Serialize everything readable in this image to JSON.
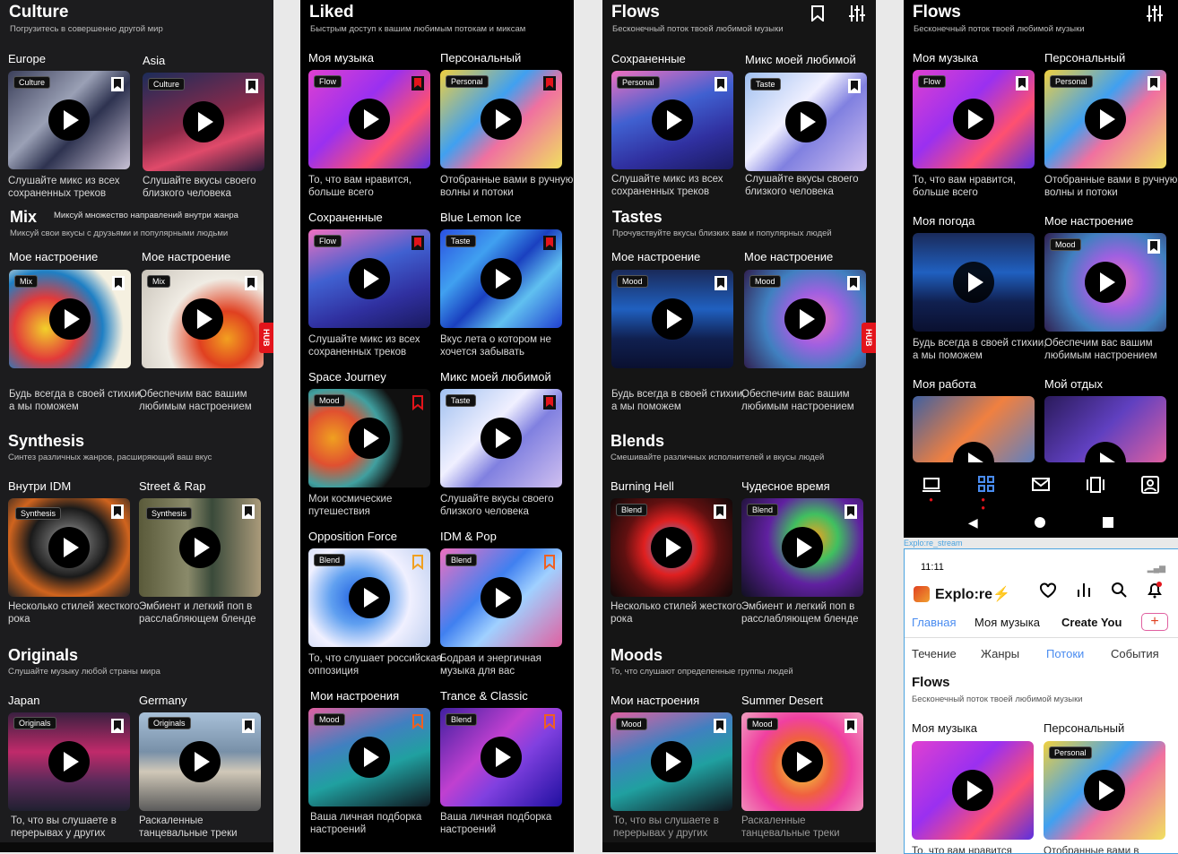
{
  "panel1": {
    "title": "Culture",
    "subtitle": "Погрузитесь в совершенно другой мир",
    "cards": [
      {
        "title": "Europe",
        "badge": "Culture",
        "desc": "Слушайте микс из всех сохраненных треков"
      },
      {
        "title": "Asia",
        "badge": "Culture",
        "desc": "Слушайте вкусы своего близкого человека"
      }
    ],
    "mix_title": "Mix",
    "mix_side": "Миксуй множество направлений внутри жанра",
    "mix_sub": "Миксуй свои вкусы с друзьями и популярными людьми",
    "mix_cards": [
      {
        "title": "Мое настроение",
        "badge": "Mix",
        "desc": "Будь всегда в своей стихии, а мы поможем"
      },
      {
        "title": "Мое настроение",
        "badge": "Mix",
        "desc": "Обеспечим вас вашим любимым настроением"
      }
    ],
    "hub": "HUB",
    "syn_title": "Synthesis",
    "syn_sub": "Синтез различных жанров, расширяющий ваш вкус",
    "syn_cards": [
      {
        "title": "Внутри IDM",
        "badge": "Synthesis",
        "desc": "Несколько стилей жесткого рока"
      },
      {
        "title": "Street & Rap",
        "badge": "Synthesis",
        "desc": "Эмбиент и легкий поп в расслабляющем бленде"
      }
    ],
    "orig_title": "Originals",
    "orig_sub": "Слушайте музыку любой страны мира",
    "orig_cards": [
      {
        "title": "Japan",
        "badge": "Originals",
        "desc": "То, что вы слушаете в перерывах у других"
      },
      {
        "title": "Germany",
        "badge": "Originals",
        "desc": "Раскаленные танцевальные треки"
      }
    ]
  },
  "panel2": {
    "title": "Liked",
    "subtitle": "Быстрым доступ к вашим любимым потокам и миксам",
    "cards": [
      {
        "title": "Моя музыка",
        "badge": "Flow",
        "desc": "То, что вам нравится, больше всего"
      },
      {
        "title": "Персональный",
        "badge": "Personal",
        "desc": "Отобранные вами в ручную волны и потоки"
      },
      {
        "title": "Сохраненные",
        "badge": "Flow",
        "desc": "Слушайте микс из всех сохраненных треков"
      },
      {
        "title": "Blue Lemon Ice",
        "badge": "Taste",
        "desc": "Вкус лета о котором не хочется забывать"
      },
      {
        "title": "Space Journey",
        "badge": "Mood",
        "desc": "Мои космические путешествия"
      },
      {
        "title": "Микс моей любимой",
        "badge": "Taste",
        "desc": "Слушайте вкусы своего близкого человека"
      },
      {
        "title": "Opposition Force",
        "badge": "Blend",
        "desc": "То, что слушает российская оппозиция"
      },
      {
        "title": "IDM & Pop",
        "badge": "Blend",
        "desc": "Бодрая и энергичная музыка для вас"
      },
      {
        "title": "Мои настроения",
        "badge": "Mood",
        "desc": "Ваша личная подборка настроений"
      },
      {
        "title": "Trance & Classic",
        "badge": "Blend",
        "desc": "Ваша личная подборка настроений"
      }
    ]
  },
  "panel3": {
    "title": "Flows",
    "subtitle": "Бесконечный поток твоей любимой музыки",
    "cards": [
      {
        "title": "Сохраненные",
        "badge": "Personal",
        "desc": "Слушайте микс из всех сохраненных треков"
      },
      {
        "title": "Микс моей любимой",
        "badge": "Taste",
        "desc": "Слушайте вкусы своего близкого человека"
      }
    ],
    "tastes_title": "Tastes",
    "tastes_sub": "Прочувствуйте вкусы близких вам и популярных людей",
    "tastes_cards": [
      {
        "title": "Мое настроение",
        "badge": "Mood",
        "desc": "Будь всегда в своей стихии, а мы поможем"
      },
      {
        "title": "Мое настроение",
        "badge": "Mood",
        "desc": "Обеспечим вас вашим любимым настроением"
      }
    ],
    "hub": "HUB",
    "blends_title": "Blends",
    "blends_sub": "Смешивайте различных исполнителей и вкусы людей",
    "blends_cards": [
      {
        "title": "Burning Hell",
        "badge": "Blend",
        "desc": "Несколько стилей жесткого рока"
      },
      {
        "title": "Чудесное время",
        "badge": "Blend",
        "desc": "Эмбиент и легкий поп в расслабляющем бленде"
      }
    ],
    "moods_title": "Moods",
    "moods_sub": "То, что слушают определенные группы людей",
    "moods_cards": [
      {
        "title": "Мои настроения",
        "badge": "Mood",
        "desc": "То, что вы слушаете в перерывах у других"
      },
      {
        "title": "Summer Desert",
        "badge": "Mood",
        "desc": "Раскаленные танцевальные треки"
      }
    ]
  },
  "panel4": {
    "title": "Flows",
    "subtitle": "Бесконечный поток твоей любимой музыки",
    "cards": [
      {
        "title": "Моя музыка",
        "badge": "Flow",
        "desc": "То, что вам нравится, больше всего"
      },
      {
        "title": "Персональный",
        "badge": "Personal",
        "desc": "Отобранные вами в ручную волны и потоки"
      },
      {
        "title": "Моя погода",
        "badge": "",
        "desc": "Будь всегда в своей стихии, а мы поможем"
      },
      {
        "title": "Мое настроение",
        "badge": "Mood",
        "desc": "Обеспечим вас вашим любимым настроением"
      },
      {
        "title": "Моя работа",
        "badge": "",
        "desc": ""
      },
      {
        "title": "Мой отдых",
        "badge": "",
        "desc": ""
      }
    ]
  },
  "phone": {
    "frame_label": "Explo:re_stream",
    "time": "11:11",
    "app_name": "Explo:re",
    "tabs": [
      "Главная",
      "Моя музыка",
      "Create You"
    ],
    "subtabs": [
      "Течение",
      "Жанры",
      "Потоки",
      "События"
    ],
    "section_title": "Flows",
    "section_sub": "Бесконечный поток твоей любимой музыки",
    "cards": [
      {
        "title": "Моя музыка",
        "badge": "",
        "desc": "То, что вам нравится"
      },
      {
        "title": "Персональный",
        "badge": "Personal",
        "desc": "Отобранные вами в"
      }
    ]
  },
  "colors": {
    "accent": "#4a8cf0",
    "hub_red": "#e3141b"
  }
}
